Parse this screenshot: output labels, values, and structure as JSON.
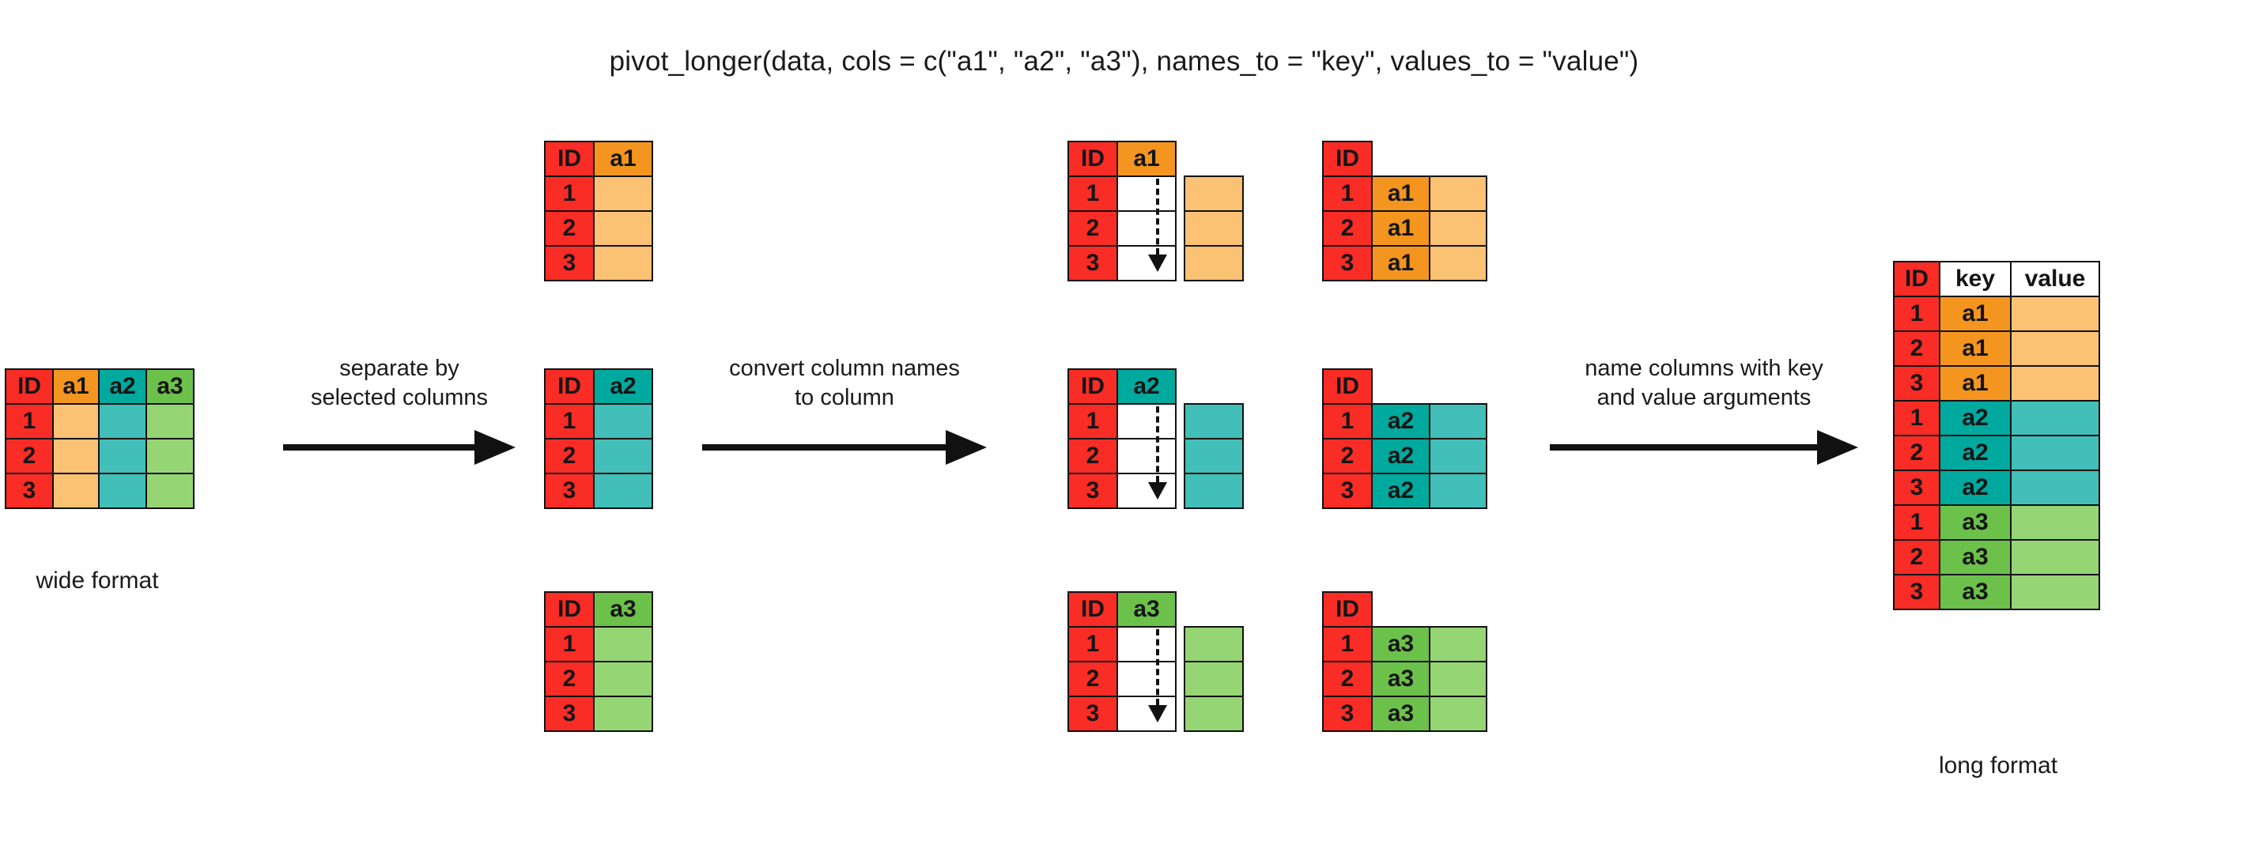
{
  "title": "pivot_longer(data, cols = c(\"a1\", \"a2\", \"a3\"), names_to = \"key\", values_to = \"value\")",
  "colors": {
    "id": "#F92C26",
    "a1_head": "#F49520",
    "a1_body": "#FBC274",
    "a2_head": "#00A99D",
    "a2_body": "#41BFB8",
    "a3_head": "#6CC14B",
    "a3_body": "#96D573",
    "white": "#FFFFFF",
    "outline": "#111111"
  },
  "stage1": {
    "caption": "wide format",
    "headers": [
      "ID",
      "a1",
      "a2",
      "a3"
    ],
    "rows": [
      [
        "1",
        "",
        "",
        ""
      ],
      [
        "2",
        "",
        "",
        ""
      ],
      [
        "3",
        "",
        "",
        ""
      ]
    ]
  },
  "arrow1": {
    "line1": "separate by",
    "line2": "selected columns"
  },
  "arrow2": {
    "line1": "convert column names",
    "line2": "to column"
  },
  "arrow3": {
    "line1": "name columns with key",
    "line2": "and value arguments"
  },
  "stage2": {
    "tables": [
      {
        "headers": [
          "ID",
          "a1"
        ],
        "ids": [
          "1",
          "2",
          "3"
        ]
      },
      {
        "headers": [
          "ID",
          "a2"
        ],
        "ids": [
          "1",
          "2",
          "3"
        ]
      },
      {
        "headers": [
          "ID",
          "a3"
        ],
        "ids": [
          "1",
          "2",
          "3"
        ]
      }
    ]
  },
  "stage3": {
    "tables": [
      {
        "headers": [
          "ID",
          "a1"
        ],
        "ids": [
          "1",
          "2",
          "3"
        ]
      },
      {
        "headers": [
          "ID",
          "a2"
        ],
        "ids": [
          "1",
          "2",
          "3"
        ]
      },
      {
        "headers": [
          "ID",
          "a3"
        ],
        "ids": [
          "1",
          "2",
          "3"
        ]
      }
    ]
  },
  "stage4": {
    "tables": [
      {
        "headers": [
          "ID"
        ],
        "ids": [
          "1",
          "2",
          "3"
        ],
        "keys": [
          "a1",
          "a1",
          "a1"
        ]
      },
      {
        "headers": [
          "ID"
        ],
        "ids": [
          "1",
          "2",
          "3"
        ],
        "keys": [
          "a2",
          "a2",
          "a2"
        ]
      },
      {
        "headers": [
          "ID"
        ],
        "ids": [
          "1",
          "2",
          "3"
        ],
        "keys": [
          "a3",
          "a3",
          "a3"
        ]
      }
    ]
  },
  "stage5": {
    "caption": "long format",
    "headers": [
      "ID",
      "key",
      "value"
    ],
    "rows": [
      {
        "id": "1",
        "key": "a1",
        "value": ""
      },
      {
        "id": "2",
        "key": "a1",
        "value": ""
      },
      {
        "id": "3",
        "key": "a1",
        "value": ""
      },
      {
        "id": "1",
        "key": "a2",
        "value": ""
      },
      {
        "id": "2",
        "key": "a2",
        "value": ""
      },
      {
        "id": "3",
        "key": "a2",
        "value": ""
      },
      {
        "id": "1",
        "key": "a3",
        "value": ""
      },
      {
        "id": "2",
        "key": "a3",
        "value": ""
      },
      {
        "id": "3",
        "key": "a3",
        "value": ""
      }
    ]
  }
}
